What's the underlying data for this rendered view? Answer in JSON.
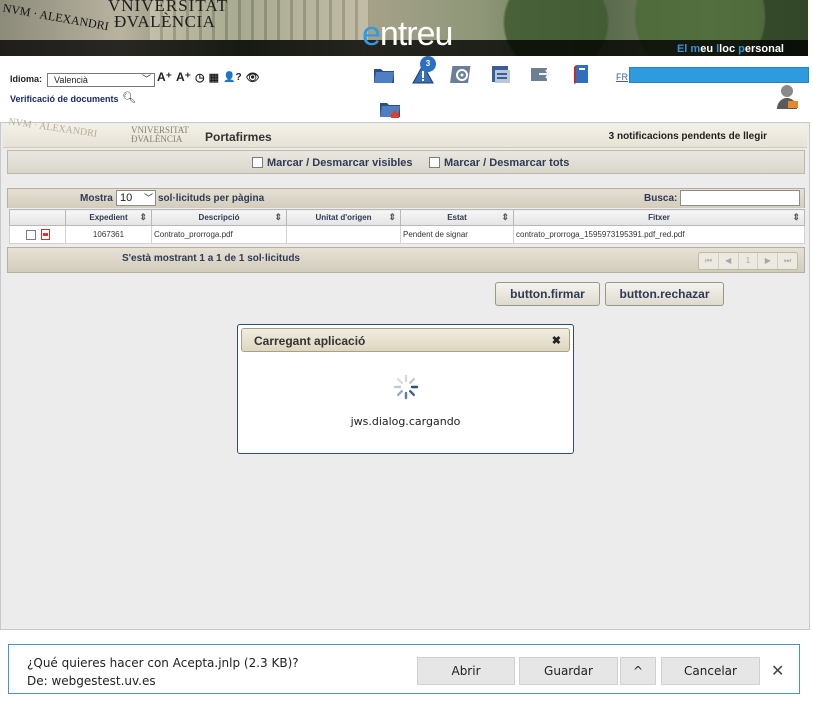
{
  "banner": {
    "logo_line1": "VNIVERSITAT",
    "logo_line2": "ÐVALÈNCIA",
    "seal": "NVM · ALEXANDRI",
    "brand_first": "e",
    "brand_rest": "ntreu",
    "tagline_parts": [
      "El ",
      "m",
      "eu ",
      "l",
      "loc ",
      "p",
      "ersonal"
    ]
  },
  "header": {
    "idioma_label": "Idioma:",
    "idioma_value": "Valencià",
    "tools": [
      "A⁺",
      "A⁺",
      "◷",
      "▦",
      "👤?",
      "👁"
    ],
    "verificacio_label": "Verificació de documents",
    "notification_badge": "3",
    "fr_link": "FR",
    "toolbar_icons": [
      "folder-icon",
      "alert-icon",
      "settings-icon",
      "inbox-icon",
      "send-icon",
      "book-icon",
      "folder-home-icon"
    ]
  },
  "portafirmes": {
    "title": "Portafirmes",
    "notifications": "3 notificacions pendents de llegir",
    "uni_line1": "VNIVERSITAT",
    "uni_line2": "ÐVALÈNCIA",
    "mark_visible": "Marcar / Desmarcar visibles",
    "mark_all": "Marcar / Desmarcar tots",
    "mostra": "Mostra",
    "per_page": "10",
    "per_page_label": "sol·licituds per pàgina",
    "busca": "Busca:",
    "columns": [
      "",
      "Expedient",
      "Descripció",
      "Unitat d'origen",
      "Estat",
      "Fitxer"
    ],
    "rows": [
      {
        "expedient": "1067361",
        "descripcio": "Contrato_prorroga.pdf",
        "unitat": "",
        "estat": "Pendent de signar",
        "fitxer": "contrato_prorroga_1595973195391.pdf_red.pdf"
      }
    ],
    "footer_info": "S'està mostrant 1 a 1 de 1 sol·licituds",
    "pager": [
      "⏮",
      "◀",
      "1",
      "▶",
      "⏭"
    ],
    "btn_firmar": "button.firmar",
    "btn_rechazar": "button.rechazar"
  },
  "dialog": {
    "title": "Carregant aplicació",
    "close": "✖",
    "message": "jws.dialog.cargando"
  },
  "download_bar": {
    "question": "¿Qué quieres hacer con Acepta.jnlp (2.3 KB)?",
    "from": "De: webgestest.uv.es",
    "open": "Abrir",
    "save": "Guardar",
    "more": "^",
    "cancel": "Cancelar",
    "close": "✕"
  },
  "colors": {
    "brand_blue": "#2e9be0",
    "header_beige": "#e6e1d4",
    "dialog_border": "#2d4d7a",
    "download_border": "#4a90d0"
  }
}
